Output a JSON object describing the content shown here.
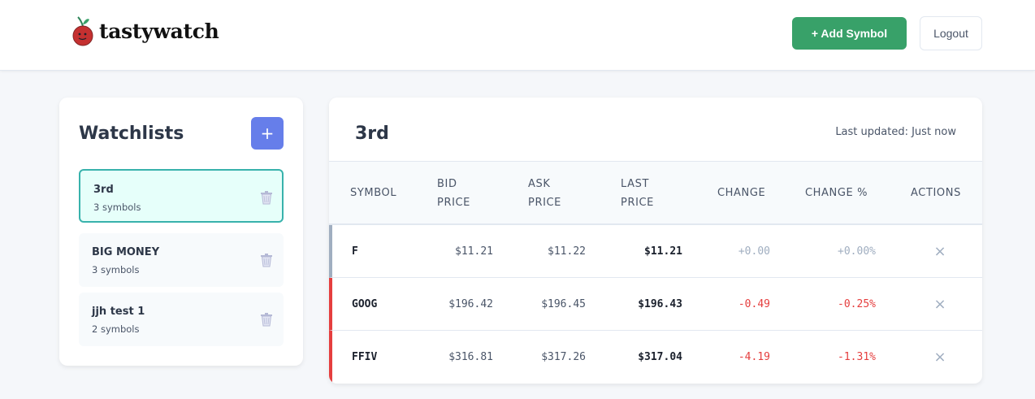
{
  "header": {
    "logo_text": "tastywatch",
    "add_symbol_label": "+ Add Symbol",
    "logout_label": "Logout"
  },
  "sidebar": {
    "title": "Watchlists",
    "add_button_label": "+",
    "items": [
      {
        "name": "3rd",
        "count": "3 symbols",
        "active": true
      },
      {
        "name": "BIG MONEY",
        "count": "3 symbols",
        "active": false
      },
      {
        "name": "jjh test 1",
        "count": "2 symbols",
        "active": false
      }
    ]
  },
  "main": {
    "title": "3rd",
    "last_updated": "Last updated: Just now",
    "columns": {
      "symbol": "SYMBOL",
      "bid_1": "BID",
      "bid_2": "PRICE",
      "ask_1": "ASK",
      "ask_2": "PRICE",
      "last_1": "LAST",
      "last_2": "PRICE",
      "change": "CHANGE",
      "change_pct": "CHANGE %",
      "actions": "ACTIONS"
    },
    "rows": [
      {
        "symbol": "F",
        "bid": "$11.21",
        "ask": "$11.22",
        "last": "$11.21",
        "change": "+0.00",
        "change_pct": "+0.00%",
        "direction": "neutral",
        "remove_icon": "×"
      },
      {
        "symbol": "GOOG",
        "bid": "$196.42",
        "ask": "$196.45",
        "last": "$196.43",
        "change": "-0.49",
        "change_pct": "-0.25%",
        "direction": "negative",
        "remove_icon": "×"
      },
      {
        "symbol": "FFIV",
        "bid": "$316.81",
        "ask": "$317.26",
        "last": "$317.04",
        "change": "-4.19",
        "change_pct": "-1.31%",
        "direction": "negative",
        "remove_icon": "×"
      }
    ]
  },
  "colors": {
    "add_symbol_bg": "#38a169",
    "new_list_bg": "#667eea",
    "active_list_border": "#38b2ac",
    "active_list_bg": "#e6fffa",
    "negative": "#e53e3e",
    "neutral": "#a0aec0"
  },
  "icons": {
    "logo": "apple-logo-icon",
    "trash": "trash-icon",
    "remove": "close-icon"
  }
}
